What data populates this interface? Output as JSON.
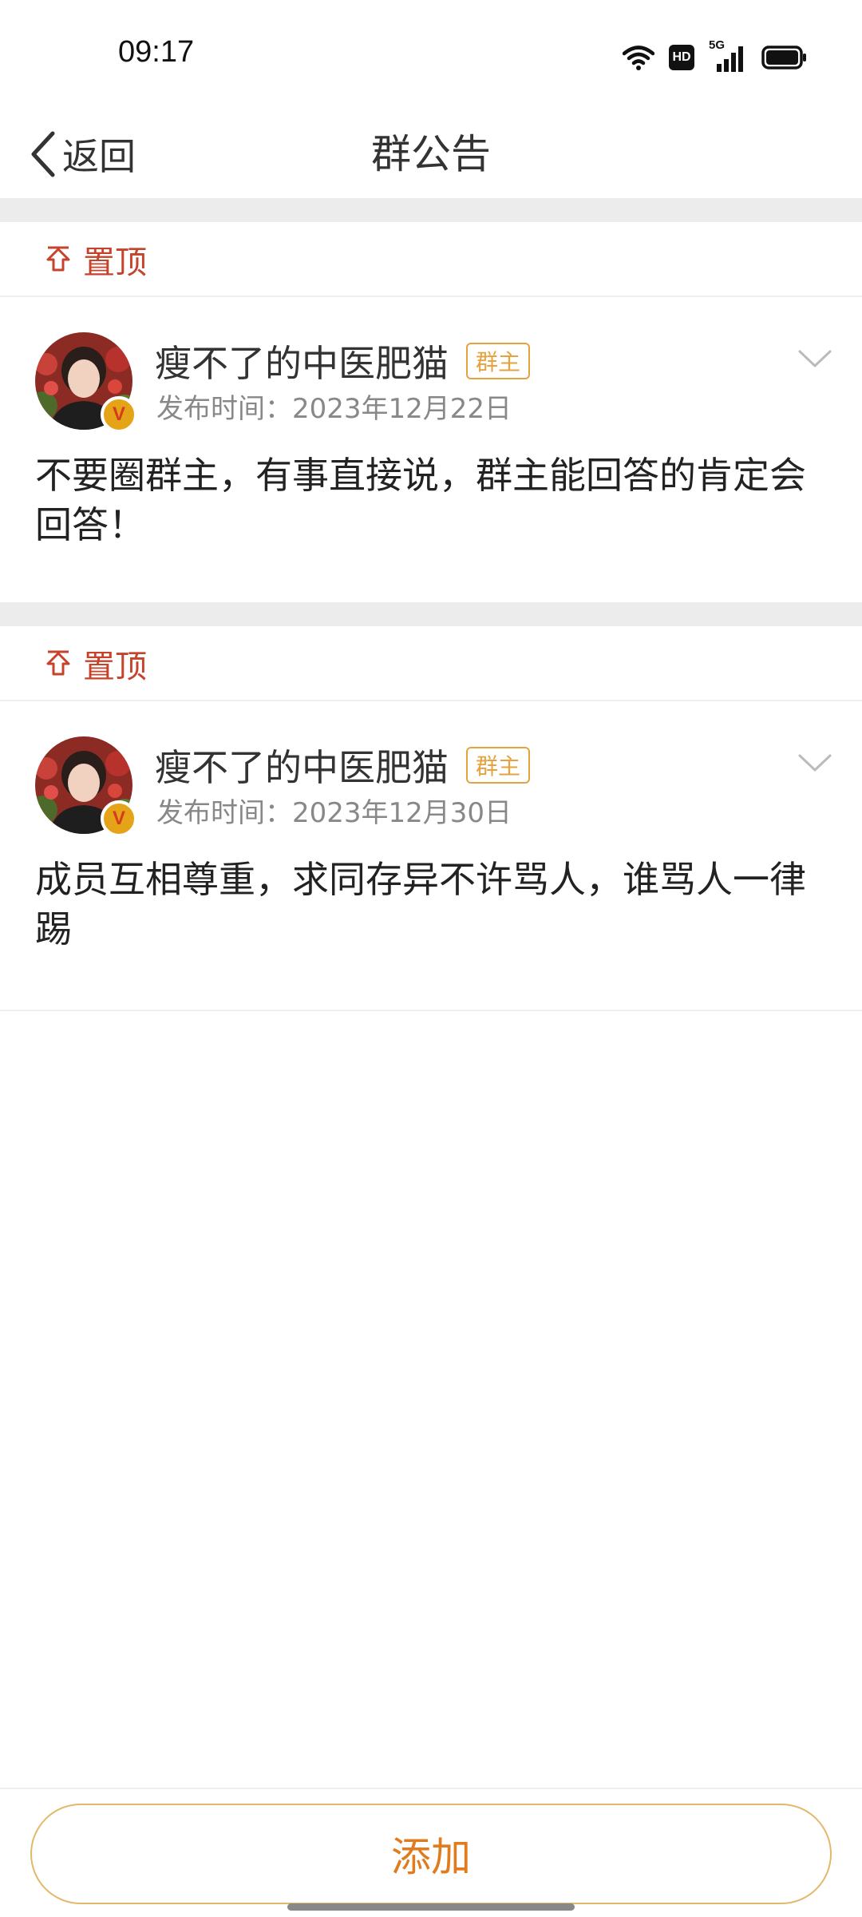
{
  "status_bar": {
    "time": "09:17",
    "hd_label": "HD",
    "network_label": "5G"
  },
  "nav": {
    "back_label": "返回",
    "title": "群公告"
  },
  "announcements": [
    {
      "pin_label": "置顶",
      "author": "瘦不了的中医肥猫",
      "role_badge": "群主",
      "publish_time": "发布时间：2023年12月22日",
      "content": "不要圈群主，有事直接说，群主能回答的肯定会回答！"
    },
    {
      "pin_label": "置顶",
      "author": "瘦不了的中医肥猫",
      "role_badge": "群主",
      "publish_time": "发布时间：2023年12月30日",
      "content": "成员互相尊重，求同存异不许骂人，谁骂人一律踢"
    }
  ],
  "verified_mark": "V",
  "add_button_label": "添加",
  "colors": {
    "pin_red": "#c5432a",
    "owner_badge_orange": "#e6a23c",
    "add_button_text": "#e07b1e",
    "add_button_border": "#e2b86a",
    "separator_gray": "#ececec"
  }
}
